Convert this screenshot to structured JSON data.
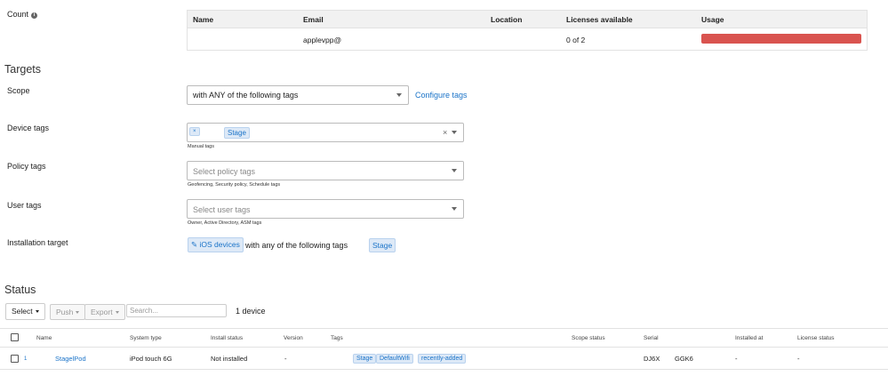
{
  "count": {
    "label": "Count",
    "icon": "info-icon",
    "table": {
      "headers": [
        "Name",
        "Email",
        "Location",
        "Licenses available",
        "Usage"
      ],
      "row": {
        "name": "",
        "email": "applevpp@",
        "location": "",
        "licenses": "0 of 2",
        "usage_fraction": 1.0
      }
    }
  },
  "targets": {
    "title": "Targets",
    "scope": {
      "label": "Scope",
      "value": "with ANY of the following tags",
      "configure_link": "Configure tags"
    },
    "device_tags": {
      "label": "Device tags",
      "remove": "×",
      "tag": "Stage",
      "clear": "×",
      "help": "Manual tags"
    },
    "policy_tags": {
      "label": "Policy tags",
      "placeholder": "Select policy tags",
      "help": "Geofencing, Security policy, Schedule tags"
    },
    "user_tags": {
      "label": "User tags",
      "placeholder": "Select user tags",
      "help": "Owner, Active Directory, ASM tags"
    },
    "installation_target": {
      "label": "Installation target",
      "chip": "iOS devices",
      "text": "with any of the following tags",
      "tag": "Stage"
    }
  },
  "status": {
    "title": "Status",
    "toolbar": {
      "select": "Select",
      "push": "Push",
      "export": "Export",
      "search_placeholder": "Search...",
      "count": "1 device"
    },
    "columns": [
      "Name",
      "System type",
      "Install status",
      "Version",
      "Tags",
      "Scope status",
      "Serial",
      "Installed at",
      "License status"
    ],
    "rows": [
      {
        "index": "1",
        "name": "StagelPod",
        "system_type": "iPod touch 6G",
        "install_status": "Not installed",
        "version": "-",
        "tags": [
          "Stage",
          "DefaultWifi",
          "recently-added"
        ],
        "scope_status": "",
        "serial_a": "DJ6X",
        "serial_b": "GGK6",
        "installed_at": "-",
        "license_status": "-"
      }
    ]
  },
  "colors": {
    "accent": "#1a73c8",
    "usage_bar": "#d9534f",
    "tag_bg": "#dde9f7"
  }
}
